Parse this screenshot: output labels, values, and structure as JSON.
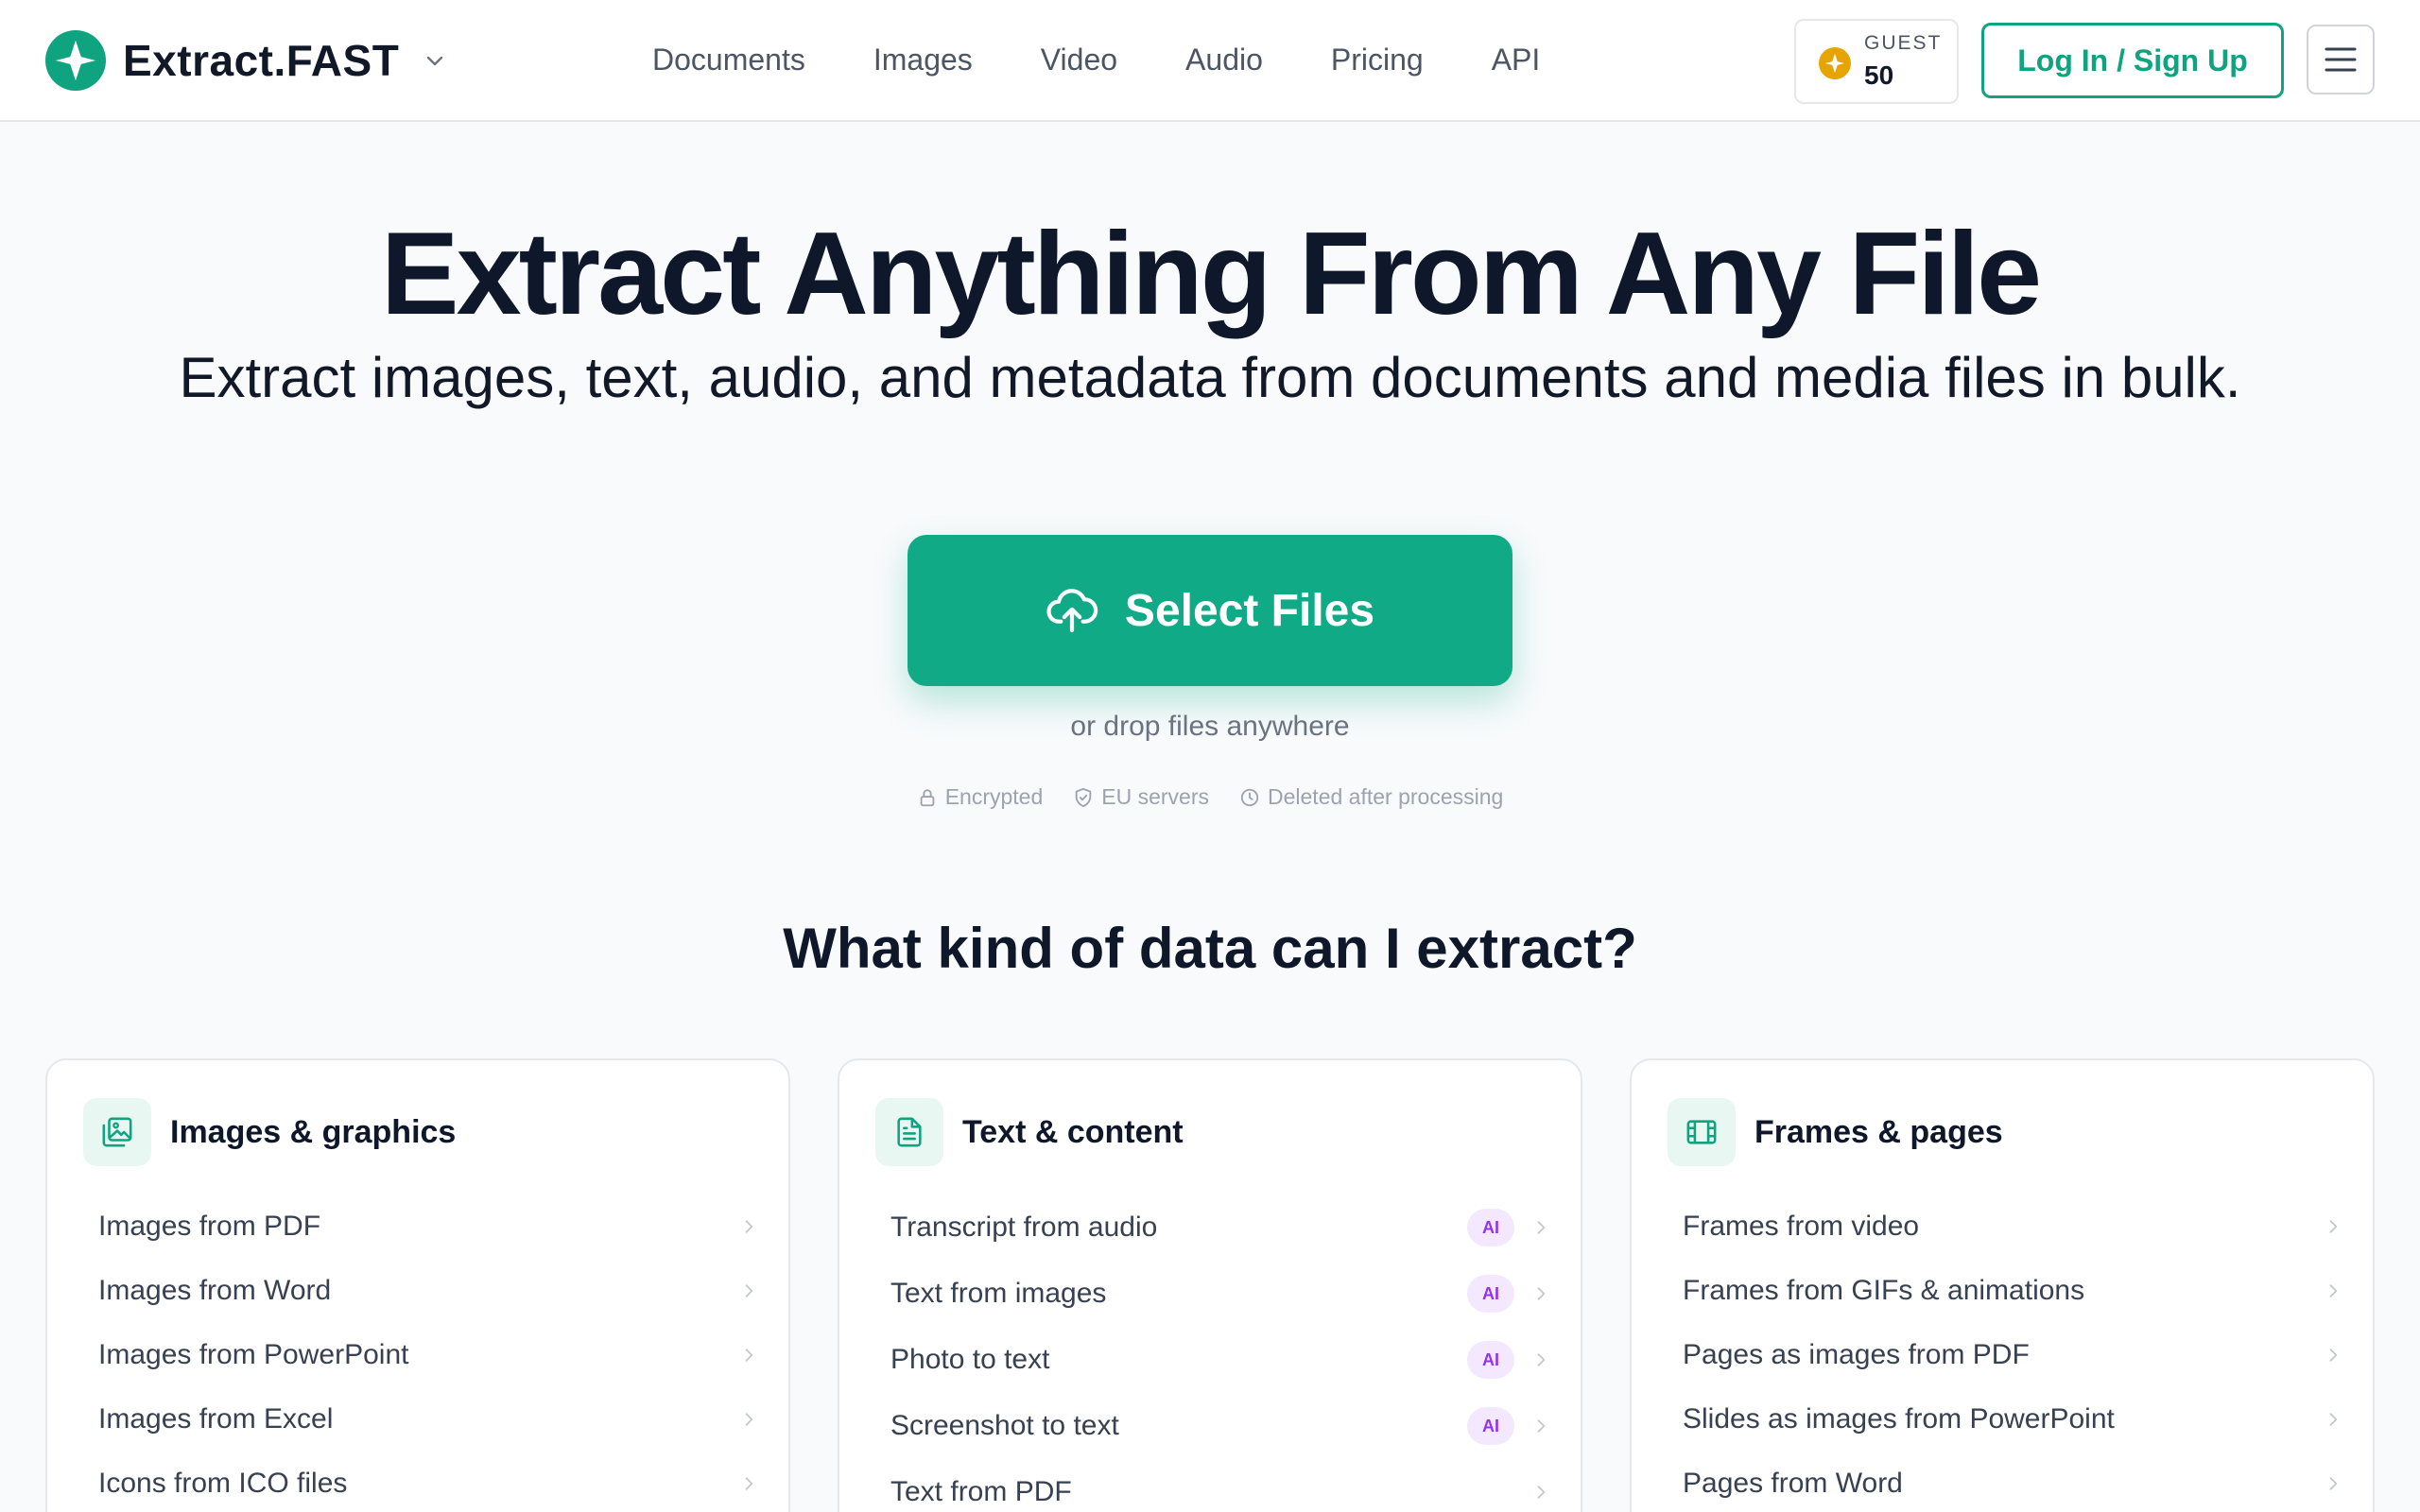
{
  "brand": {
    "name": "Extract.FAST"
  },
  "nav": [
    "Documents",
    "Images",
    "Video",
    "Audio",
    "Pricing",
    "API"
  ],
  "credits": {
    "label": "GUEST",
    "count": "50"
  },
  "auth": {
    "login_label": "Log In / Sign Up"
  },
  "hero": {
    "title": "Extract Anything From Any File",
    "subtitle": "Extract images, text, audio, and metadata from documents and media files in bulk.",
    "select_label": "Select Files",
    "drop_hint": "or drop files anywhere",
    "badges": [
      "Encrypted",
      "EU servers",
      "Deleted after processing"
    ]
  },
  "section": {
    "title": "What kind of data can I extract?"
  },
  "cards": [
    {
      "title": "Images & graphics",
      "icon": "image-icon",
      "items": [
        {
          "label": "Images from PDF"
        },
        {
          "label": "Images from Word"
        },
        {
          "label": "Images from PowerPoint"
        },
        {
          "label": "Images from Excel"
        },
        {
          "label": "Icons from ICO files"
        }
      ]
    },
    {
      "title": "Text & content",
      "icon": "document-icon",
      "items": [
        {
          "label": "Transcript from audio",
          "tag": "AI"
        },
        {
          "label": "Text from images",
          "tag": "AI"
        },
        {
          "label": "Photo to text",
          "tag": "AI"
        },
        {
          "label": "Screenshot to text",
          "tag": "AI"
        },
        {
          "label": "Text from PDF"
        }
      ]
    },
    {
      "title": "Frames & pages",
      "icon": "film-icon",
      "items": [
        {
          "label": "Frames from video"
        },
        {
          "label": "Frames from GIFs & animations"
        },
        {
          "label": "Pages as images from PDF"
        },
        {
          "label": "Slides as images from PowerPoint"
        },
        {
          "label": "Pages from Word"
        }
      ]
    }
  ],
  "colors": {
    "accent": "#10ab86",
    "ai_tag_bg": "#f3e8ff",
    "ai_tag_text": "#9333ea",
    "coin": "#e5a400"
  }
}
